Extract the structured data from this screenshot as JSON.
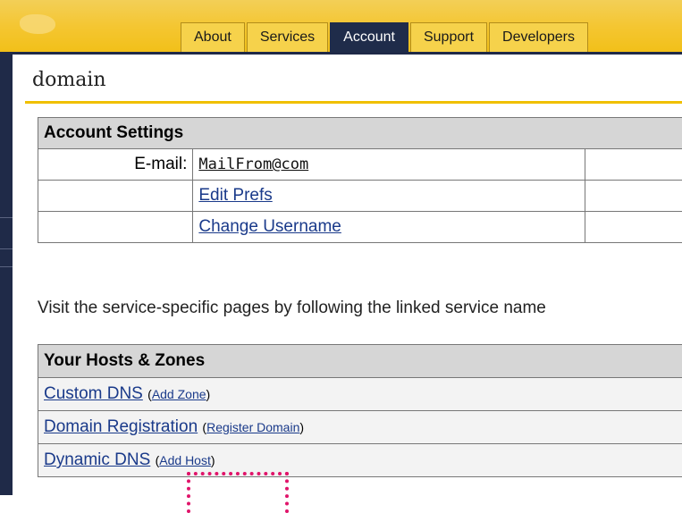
{
  "header": {
    "tabs": [
      {
        "label": "About"
      },
      {
        "label": "Services"
      },
      {
        "label": "Account"
      },
      {
        "label": "Support"
      },
      {
        "label": "Developers"
      }
    ],
    "active_tab": "Account"
  },
  "page": {
    "title": "domain"
  },
  "account_settings": {
    "heading": "Account Settings",
    "email_label": "E-mail:",
    "email_value": "MailFrom@com",
    "edit_prefs": "Edit Prefs",
    "change_username": "Change Username"
  },
  "visit_text": "Visit the service-specific pages by following the linked service name",
  "hosts": {
    "heading": "Your Hosts & Zones",
    "rows": [
      {
        "name": "Custom DNS",
        "open": "(",
        "action": "Add Zone",
        "close": ")"
      },
      {
        "name": "Domain Registration",
        "open": "(",
        "action": "Register Domain",
        "close": ")"
      },
      {
        "name": "Dynamic DNS",
        "open": "(",
        "action": "Add Host",
        "close": ")"
      }
    ]
  },
  "colors": {
    "header_yellow": "#f4c631",
    "active_tab": "#1f2c4a",
    "link": "#1a3a8a",
    "highlight": "#e0146a"
  }
}
